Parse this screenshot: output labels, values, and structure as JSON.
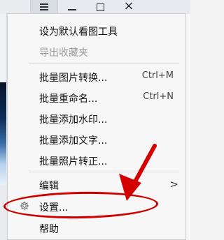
{
  "window_controls": {
    "menu_icon": "menu-icon",
    "minimize_icon": "minimize-icon",
    "maximize_icon": "maximize-icon",
    "close_icon": "close-icon",
    "close_text": "×"
  },
  "menu": {
    "items": [
      {
        "label": "设为默认看图工具",
        "shortcut": "",
        "disabled": false
      },
      {
        "label": "导出收藏夹",
        "shortcut": "",
        "disabled": true
      },
      {
        "label": "批量图片转换...",
        "shortcut": "Ctrl+M",
        "disabled": false
      },
      {
        "label": "批量重命名...",
        "shortcut": "Ctrl+N",
        "disabled": false
      },
      {
        "label": "批量添加水印...",
        "shortcut": "",
        "disabled": false
      },
      {
        "label": "批量添加文字...",
        "shortcut": "",
        "disabled": false
      },
      {
        "label": "批量照片转正...",
        "shortcut": "",
        "disabled": false
      },
      {
        "label": "编辑",
        "shortcut": "",
        "disabled": false,
        "submenu_indicator": ">"
      },
      {
        "label": "设置...",
        "shortcut": "",
        "disabled": false,
        "icon": "gear-icon"
      },
      {
        "label": "帮助",
        "shortcut": "",
        "disabled": false
      }
    ]
  },
  "annotation": {
    "arrow_color": "#d40000",
    "highlight_color": "#d00000"
  }
}
